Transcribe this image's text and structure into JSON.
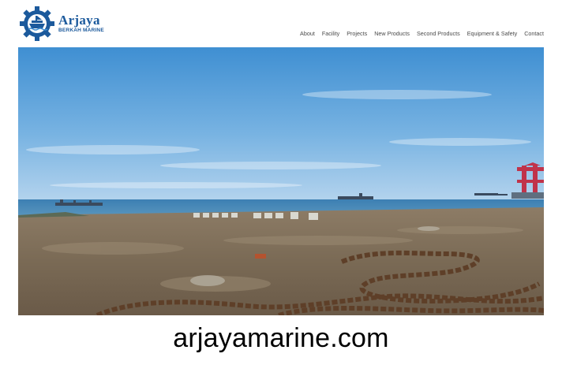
{
  "logo": {
    "name": "Arjaya",
    "subtitle": "BERKAH MARINE"
  },
  "nav": {
    "items": [
      "About",
      "Facility",
      "Projects",
      "New Products",
      "Second Products",
      "Equipment & Safety",
      "Contact"
    ]
  },
  "caption": "arjayamarine.com",
  "colors": {
    "brand": "#1c5a9c",
    "nav_text": "#4a4a4a",
    "sky_top": "#3f8fd2",
    "sea": "#3b7fb0",
    "ground": "#7a6a55"
  },
  "icons": {
    "logo_mark": "gear-ship-icon"
  }
}
